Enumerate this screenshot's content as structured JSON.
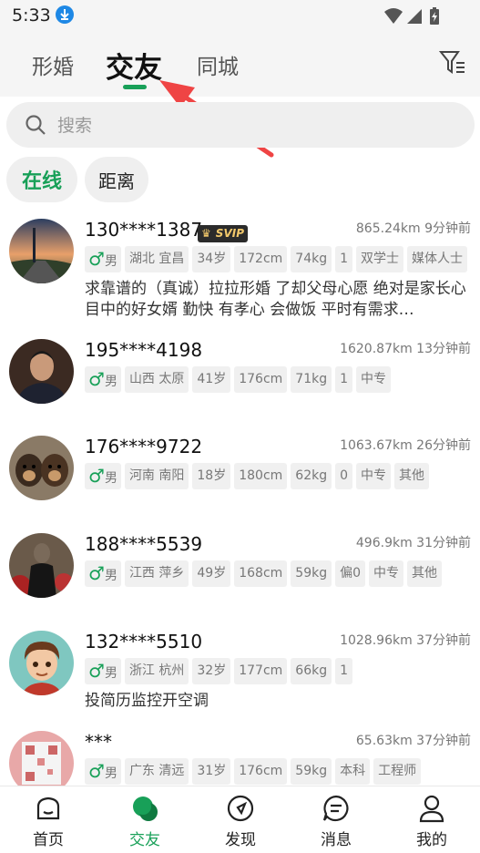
{
  "status_bar": {
    "time": "5:33",
    "download_icon": "download-icon",
    "wifi_icon": "wifi-icon",
    "signal_icon": "signal-icon",
    "battery_icon": "battery-icon"
  },
  "header": {
    "tabs": [
      {
        "label": "形婚",
        "active": false
      },
      {
        "label": "交友",
        "active": true
      },
      {
        "label": "同城",
        "active": false
      }
    ],
    "filter_icon": "filter-icon",
    "accent": "#18a058"
  },
  "search": {
    "placeholder": "搜索"
  },
  "chips": [
    {
      "label": "在线",
      "active": true
    },
    {
      "label": "距离",
      "active": false
    }
  ],
  "users": [
    {
      "name": "130****1387",
      "svip": "SVIP",
      "distance": "865.24km",
      "time": "9分钟前",
      "gender": "男",
      "tags": [
        "湖北 宜昌",
        "34岁",
        "172cm",
        "74kg",
        "1",
        "双学士",
        "媒体人士"
      ],
      "bio": "求靠谱的（真诚）拉拉形婚 了却父母心愿 绝对是家长心目中的好女婿 勤快 有孝心 会做饭 平时有需求…"
    },
    {
      "name": "195****4198",
      "distance": "1620.87km",
      "time": "13分钟前",
      "gender": "男",
      "tags": [
        "山西 太原",
        "41岁",
        "176cm",
        "71kg",
        "1",
        "中专"
      ],
      "bio": ""
    },
    {
      "name": "176****9722",
      "distance": "1063.67km",
      "time": "26分钟前",
      "gender": "男",
      "tags": [
        "河南 南阳",
        "18岁",
        "180cm",
        "62kg",
        "0",
        "中专",
        "其他"
      ],
      "bio": ""
    },
    {
      "name": "188****5539",
      "distance": "496.9km",
      "time": "31分钟前",
      "gender": "男",
      "tags": [
        "江西 萍乡",
        "49岁",
        "168cm",
        "59kg",
        "偏0",
        "中专",
        "其他"
      ],
      "bio": ""
    },
    {
      "name": "132****5510",
      "distance": "1028.96km",
      "time": "37分钟前",
      "gender": "男",
      "tags": [
        "浙江 杭州",
        "32岁",
        "177cm",
        "66kg",
        "1"
      ],
      "bio": "投简历监控开空调"
    },
    {
      "name": "***",
      "distance": "65.63km",
      "time": "37分钟前",
      "gender": "男",
      "tags": [
        "广东 清远",
        "31岁",
        "176cm",
        "59kg",
        "本科",
        "工程师"
      ],
      "bio": ""
    }
  ],
  "bottom_nav": [
    {
      "label": "首页",
      "icon": "home-icon",
      "active": false
    },
    {
      "label": "交友",
      "icon": "chat-bubbles-icon",
      "active": true
    },
    {
      "label": "发现",
      "icon": "compass-icon",
      "active": false
    },
    {
      "label": "消息",
      "icon": "message-icon",
      "active": false
    },
    {
      "label": "我的",
      "icon": "profile-icon",
      "active": false
    }
  ]
}
